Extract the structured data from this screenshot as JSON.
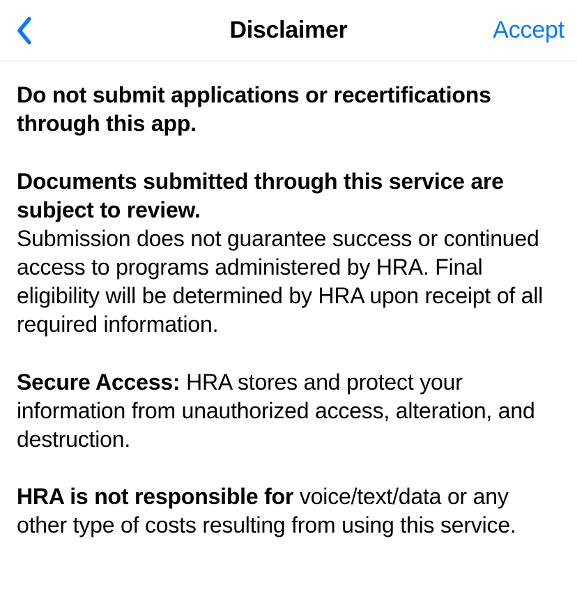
{
  "nav": {
    "title": "Disclaimer",
    "accept_label": "Accept"
  },
  "content": {
    "para1_bold": "Do not submit applications or recertifications through this app.",
    "para2_bold": "Documents submitted through this service are subject to review.",
    "para2_rest": "Submission does not guarantee success or continued access to programs administered by HRA. Final eligibility will be determined by HRA upon receipt of all required information.",
    "para3_bold": "Secure Access: ",
    "para3_rest": "HRA stores and protect your information from unauthorized access, alteration, and destruction.",
    "para4_bold": "HRA is not responsible for ",
    "para4_rest": "voice/text/data or any other type of costs resulting from using this service."
  }
}
